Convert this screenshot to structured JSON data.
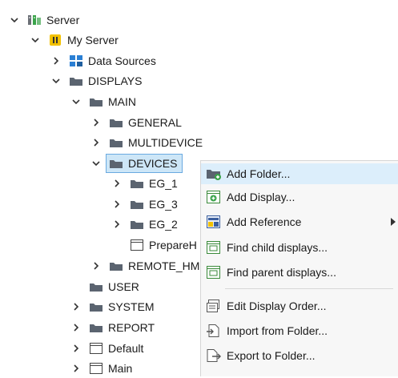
{
  "tree": {
    "server": "Server",
    "my_server": "My Server",
    "data_sources": "Data Sources",
    "displays": "DISPLAYS",
    "main": "MAIN",
    "general": "GENERAL",
    "multidevice": "MULTIDEVICE",
    "devices": "DEVICES",
    "eg1": "EG_1",
    "eg3": "EG_3",
    "eg2": "EG_2",
    "prepare": "PrepareH",
    "remote_hm": "REMOTE_HM",
    "user": "USER",
    "system": "SYSTEM",
    "report": "REPORT",
    "default": "Default",
    "main_display": "Main"
  },
  "context_menu": {
    "add_folder": "Add Folder...",
    "add_display": "Add Display...",
    "add_reference": "Add Reference",
    "find_child": "Find child displays...",
    "find_parent": "Find parent displays...",
    "edit_order": "Edit Display Order...",
    "import_folder": "Import from Folder...",
    "export_folder": "Export to Folder..."
  },
  "colors": {
    "folder": "#5b6470",
    "selection": "#cde6f7",
    "menu_hover": "#dceefb",
    "accent_green": "#3aa34a",
    "accent_yellow": "#f2c100"
  }
}
